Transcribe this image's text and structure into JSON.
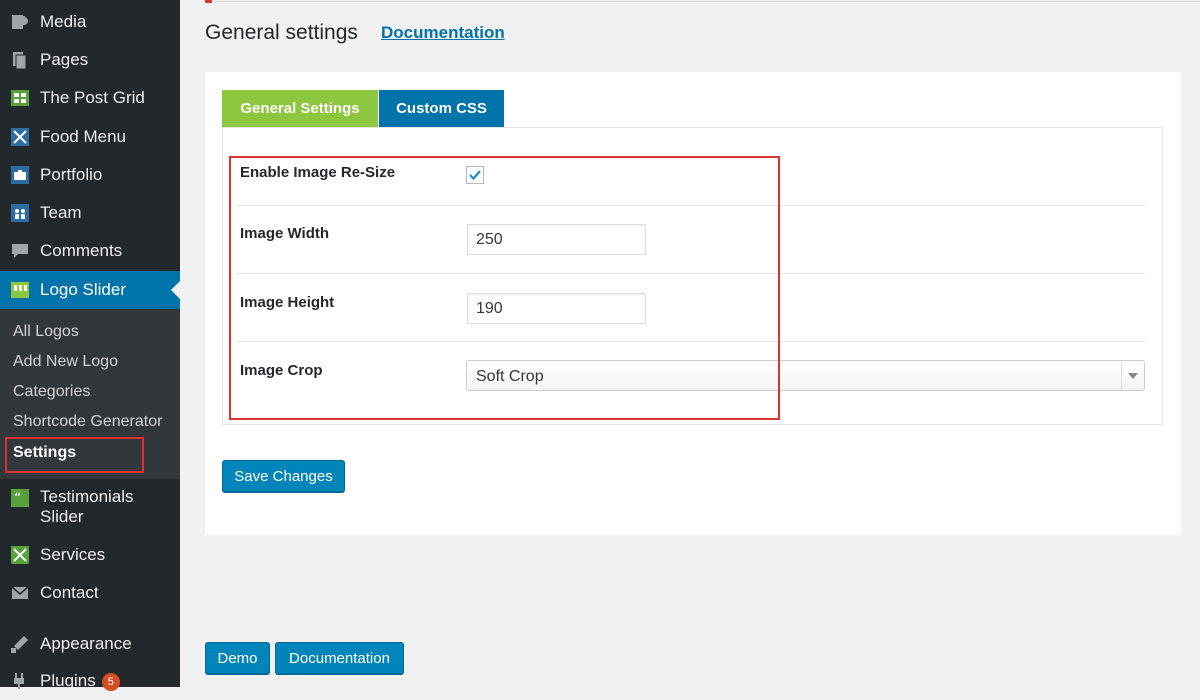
{
  "sidebar": {
    "items": [
      {
        "label": "Media",
        "icon": "media-icon"
      },
      {
        "label": "Pages",
        "icon": "pages-icon"
      },
      {
        "label": "The Post Grid",
        "icon": "grid-icon"
      },
      {
        "label": "Food Menu",
        "icon": "food-menu-icon"
      },
      {
        "label": "Portfolio",
        "icon": "portfolio-icon"
      },
      {
        "label": "Team",
        "icon": "team-icon"
      },
      {
        "label": "Comments",
        "icon": "comments-icon"
      },
      {
        "label": "Logo Slider",
        "icon": "logo-slider-icon",
        "current": true
      },
      {
        "label": "Testimonials",
        "label2": "Slider",
        "icon": "testimonials-icon"
      },
      {
        "label": "Services",
        "icon": "services-icon"
      },
      {
        "label": "Contact",
        "icon": "mail-icon"
      },
      {
        "label": "Appearance",
        "icon": "appearance-icon"
      },
      {
        "label": "Plugins",
        "icon": "plugins-icon",
        "badge": "5"
      }
    ],
    "submenu": [
      "All Logos",
      "Add New Logo",
      "Categories",
      "Shortcode Generator",
      "Settings"
    ]
  },
  "header": {
    "title": "General settings",
    "doc_link": "Documentation"
  },
  "tabs": {
    "general": "General Settings",
    "css": "Custom CSS"
  },
  "form": {
    "resize_label": "Enable Image Re-Size",
    "resize_checked": true,
    "width_label": "Image Width",
    "width_value": "250",
    "height_label": "Image Height",
    "height_value": "190",
    "crop_label": "Image Crop",
    "crop_value": "Soft Crop"
  },
  "buttons": {
    "save": "Save Changes",
    "demo": "Demo",
    "documentation": "Documentation"
  },
  "colors": {
    "sidebar_bg": "#23282d",
    "accent_blue": "#0073aa",
    "tab_green": "#8dc63f",
    "highlight_red": "#dc3232"
  }
}
